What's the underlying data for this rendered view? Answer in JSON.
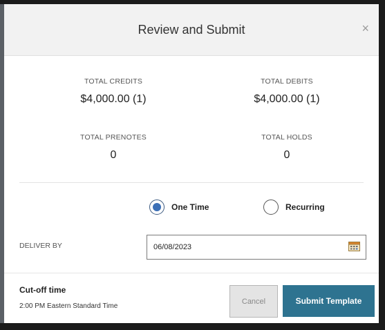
{
  "modal": {
    "title": "Review and Submit",
    "close_glyph": "×"
  },
  "totals": {
    "credits": {
      "label": "TOTAL CREDITS",
      "value": "$4,000.00 (1)"
    },
    "debits": {
      "label": "TOTAL DEBITS",
      "value": "$4,000.00 (1)"
    },
    "prenotes": {
      "label": "TOTAL PRENOTES",
      "value": "0"
    },
    "holds": {
      "label": "TOTAL HOLDS",
      "value": "0"
    }
  },
  "frequency": {
    "selected": "One Time",
    "options": [
      {
        "label": "One Time",
        "checked": true
      },
      {
        "label": "Recurring",
        "checked": false
      }
    ]
  },
  "deliver_by": {
    "label": "DELIVER BY",
    "value": "06/08/2023",
    "icon": "calendar-icon"
  },
  "cutoff": {
    "title": "Cut-off time",
    "detail": "2:00 PM Eastern Standard Time"
  },
  "buttons": {
    "cancel": "Cancel",
    "submit": "Submit Template"
  },
  "colors": {
    "primary": "#2e7390",
    "radio_selected": "#3b6fb6",
    "header_bg": "#f2f2f2"
  }
}
